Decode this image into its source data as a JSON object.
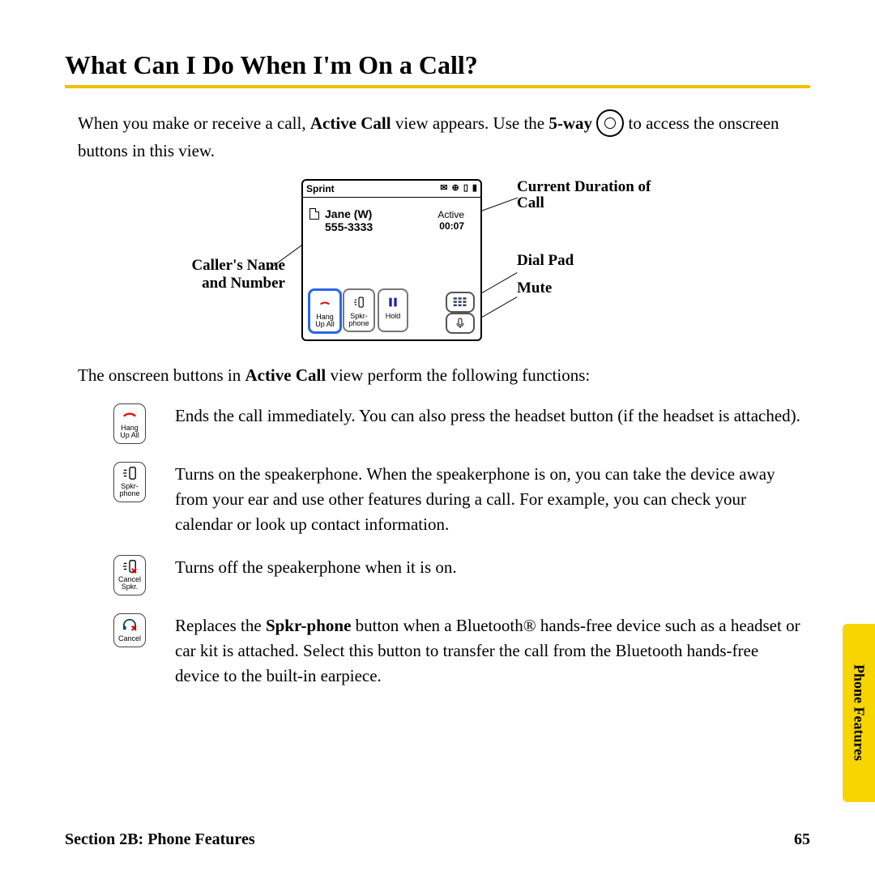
{
  "heading": "What Can I Do When I'm On a Call?",
  "intro": {
    "pre": "When you make or receive a call, ",
    "b1": "Active Call",
    "mid": " view appears. Use the ",
    "b2": "5-way",
    "post": " to access the onscreen buttons in this view."
  },
  "screen": {
    "carrier": "Sprint",
    "caller_name": "Jane (W)",
    "caller_number": "555-3333",
    "status": "Active",
    "duration": "00:07",
    "buttons": {
      "b1": "Hang\nUp All",
      "b2": "Spkr-\nphone",
      "b3": "Hold"
    }
  },
  "callouts": {
    "caller": "Caller's Name and Number",
    "duration": "Current Duration of Call",
    "dialpad": "Dial Pad",
    "mute": "Mute"
  },
  "lead": {
    "pre": "The onscreen buttons in ",
    "b": "Active Call",
    "post": " view perform the following functions:"
  },
  "fn1": {
    "label": "Hang\nUp All",
    "text": "Ends the call immediately. You can also press the headset button (if the headset is attached)."
  },
  "fn2": {
    "label": "Spkr-\nphone",
    "text": "Turns on the speakerphone. When the speakerphone is on, you can take the device away from your ear and use other features during a call. For example, you can check your calendar or look up contact information."
  },
  "fn3": {
    "label": "Cancel\nSpkr.",
    "text": "Turns off the speakerphone when it is on."
  },
  "fn4": {
    "label": "Cancel",
    "pre": "Replaces the ",
    "b": "Spkr-phone",
    "post": " button when a Bluetooth® hands-free device such as a headset or car kit is attached. Select this button to transfer the call from the Bluetooth hands-free device to the built-in earpiece."
  },
  "side_tab": "Phone Features",
  "footer_left": "Section 2B: Phone Features",
  "footer_right": "65"
}
